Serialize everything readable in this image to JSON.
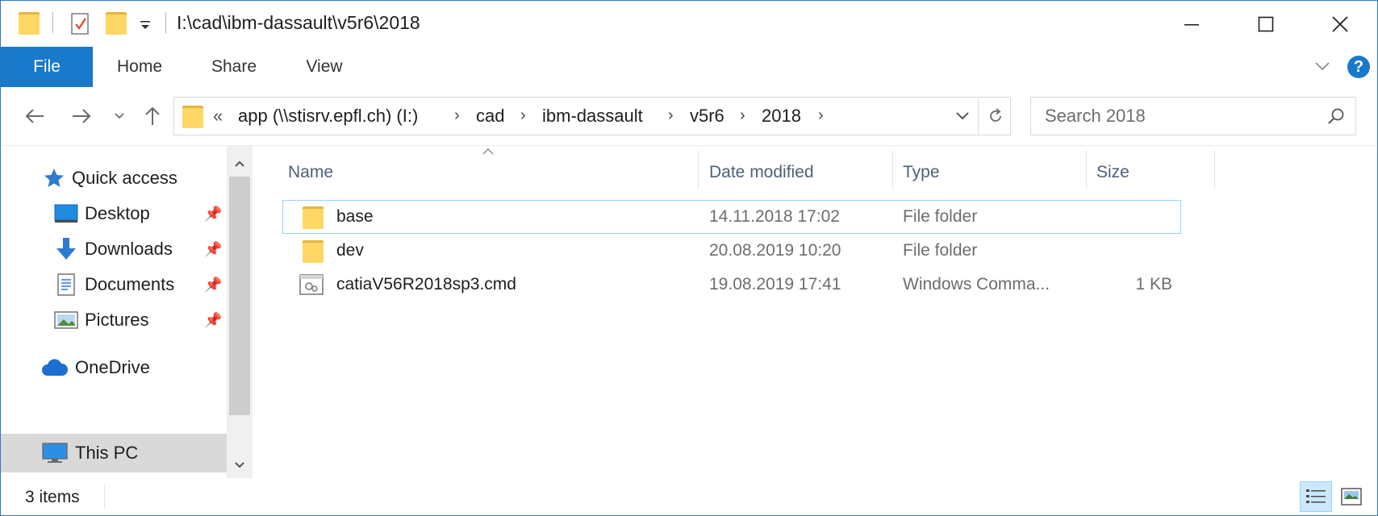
{
  "window": {
    "title": "I:\\cad\\ibm-dassault\\v5r6\\2018",
    "controls": {
      "minimize": "—",
      "maximize": "☐",
      "close": "✕"
    }
  },
  "ribbon": {
    "tabs": [
      "File",
      "Home",
      "Share",
      "View"
    ],
    "help": "?"
  },
  "address": {
    "overflow": "«",
    "crumbs": [
      "app (\\\\stisrv.epfl.ch) (I:)",
      "cad",
      "ibm-dassault",
      "v5r6",
      "2018"
    ],
    "separator": "›"
  },
  "search": {
    "placeholder": "Search 2018"
  },
  "nav_pane": {
    "quick_access": "Quick access",
    "pinned": [
      "Desktop",
      "Downloads",
      "Documents",
      "Pictures"
    ],
    "onedrive": "OneDrive",
    "this_pc": "This PC"
  },
  "columns": {
    "name": "Name",
    "date": "Date modified",
    "type": "Type",
    "size": "Size"
  },
  "files": [
    {
      "name": "base",
      "date": "14.11.2018 17:02",
      "type": "File folder",
      "size": "",
      "icon": "folder-icon"
    },
    {
      "name": "dev",
      "date": "20.08.2019 10:20",
      "type": "File folder",
      "size": "",
      "icon": "folder-icon"
    },
    {
      "name": "catiaV56R2018sp3.cmd",
      "date": "19.08.2019 17:41",
      "type": "Windows Comma...",
      "size": "1 KB",
      "icon": "cmd-file-icon"
    }
  ],
  "status": {
    "item_count": "3 items"
  },
  "colors": {
    "accent": "#1979ca",
    "selection_border": "#99d1ff",
    "folder": "#ffd766"
  }
}
